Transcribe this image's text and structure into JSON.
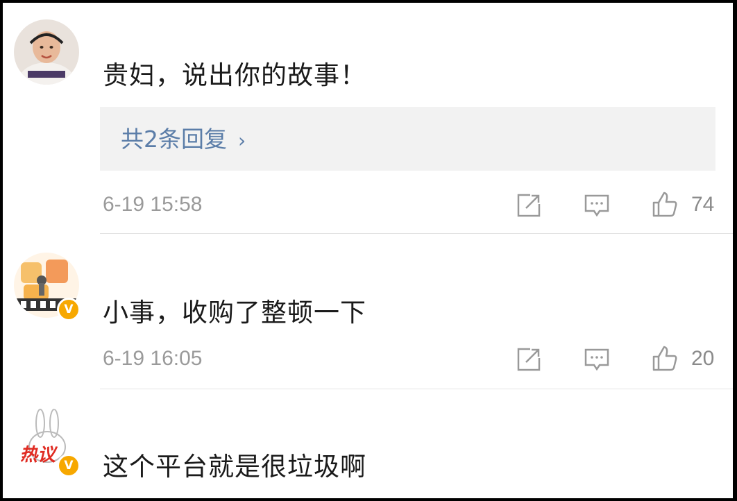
{
  "comments": [
    {
      "text": "贵妇，说出你的故事！",
      "replies_label": "共2条回复",
      "time": "6-19 15:58",
      "likes": "74",
      "verified": false
    },
    {
      "text": "小事，收购了整顿一下",
      "time": "6-19 16:05",
      "likes": "20",
      "verified": true,
      "badge": "V"
    },
    {
      "text": "这个平台就是很垃圾啊",
      "verified": true,
      "badge": "V",
      "avatar_text": "热议"
    }
  ],
  "colors": {
    "text": "#1a1a1a",
    "reply_link": "#5b7da8",
    "meta": "#9a9a9a",
    "verified_badge": "#f7a800",
    "reply_box_bg": "#f2f2f2"
  },
  "icons": [
    "share-icon",
    "comment-icon",
    "like-thumb-icon"
  ]
}
